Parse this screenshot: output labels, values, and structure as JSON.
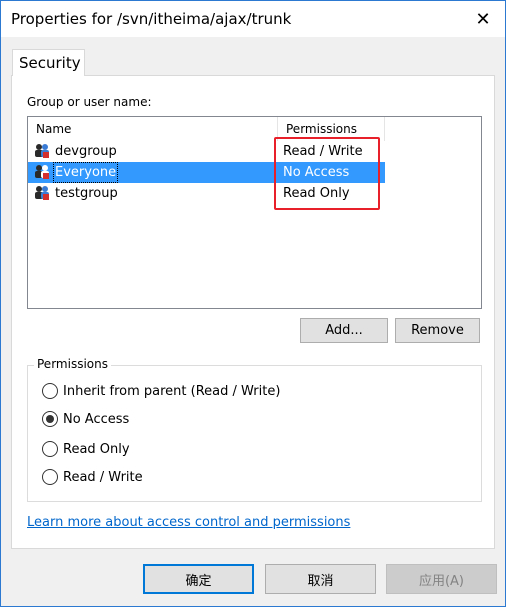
{
  "window": {
    "title": "Properties for /svn/itheima/ajax/trunk",
    "close_glyph": "✕"
  },
  "tabs": [
    {
      "label": "Security"
    }
  ],
  "security": {
    "group_label": "Group or user name:",
    "columns": {
      "name": "Name",
      "permissions": "Permissions"
    },
    "rows": [
      {
        "name": "devgroup",
        "permission": "Read / Write",
        "icon": "group-icon",
        "selected": false
      },
      {
        "name": "Everyone",
        "permission": "No Access",
        "icon": "group-icon",
        "selected": true
      },
      {
        "name": "testgroup",
        "permission": "Read Only",
        "icon": "group-icon",
        "selected": false
      }
    ],
    "add_label": "Add...",
    "remove_label": "Remove",
    "permissions_title": "Permissions",
    "options": [
      {
        "label": "Inherit from parent (Read / Write)",
        "checked": false
      },
      {
        "label": "No Access",
        "checked": true
      },
      {
        "label": "Read Only",
        "checked": false
      },
      {
        "label": "Read / Write",
        "checked": false
      }
    ],
    "learn_more": "Learn more about access control and permissions"
  },
  "footer": {
    "ok_label": "确定",
    "cancel_label": "取消",
    "apply_label": "应用(A)"
  },
  "colors": {
    "selection": "#3399ff",
    "highlight_box": "#e8202a",
    "link": "#0066cc",
    "accent_border": "#0078d7"
  }
}
